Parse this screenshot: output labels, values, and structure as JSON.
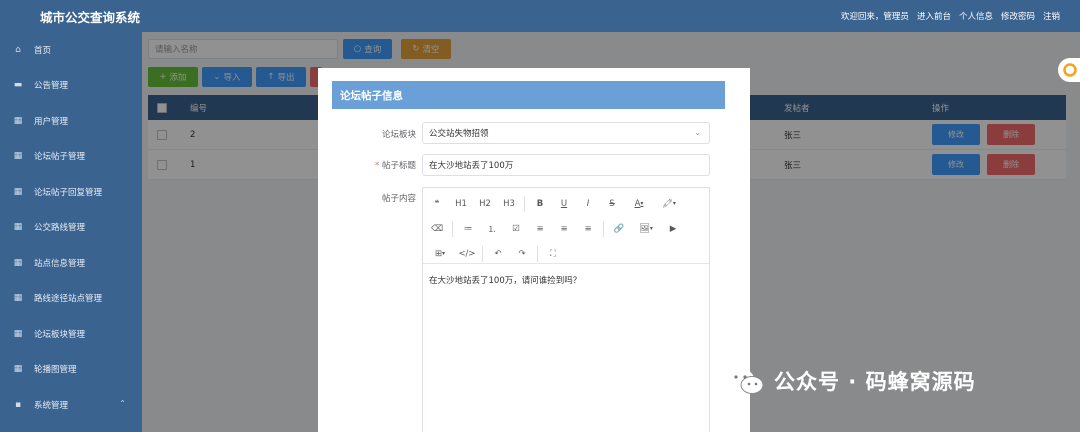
{
  "header": {
    "title": "城市公交查询系统",
    "welcome": "欢迎回来，管理员",
    "links": [
      "进入前台",
      "个人信息",
      "修改密码",
      "注销"
    ]
  },
  "sidebar": {
    "items": [
      {
        "label": "首页",
        "icon": "home-icon"
      },
      {
        "label": "公告管理",
        "icon": "message-icon"
      },
      {
        "label": "用户管理",
        "icon": "grid-icon"
      },
      {
        "label": "论坛帖子管理",
        "icon": "grid-icon"
      },
      {
        "label": "论坛帖子回复管理",
        "icon": "grid-icon"
      },
      {
        "label": "公交路线管理",
        "icon": "grid-icon"
      },
      {
        "label": "站点信息管理",
        "icon": "grid-icon"
      },
      {
        "label": "路线途径站点管理",
        "icon": "grid-icon"
      },
      {
        "label": "论坛板块管理",
        "icon": "grid-icon"
      },
      {
        "label": "轮播图管理",
        "icon": "grid-icon"
      },
      {
        "label": "系统管理",
        "icon": "settings-grid-icon"
      }
    ]
  },
  "search": {
    "placeholder": "请输入名称",
    "query_label": "查询",
    "clear_label": "清空"
  },
  "toolbar": {
    "add_label": "添加",
    "import_label": "导入",
    "export_label": "导出"
  },
  "table": {
    "headers": [
      "编号",
      "发帖者",
      "操作"
    ],
    "rows": [
      {
        "id": "2",
        "author": "张三",
        "edit": "修改",
        "delete": "删除"
      },
      {
        "id": "1",
        "author": "张三",
        "edit": "修改",
        "delete": "删除"
      }
    ]
  },
  "modal": {
    "title": "论坛帖子信息",
    "board_label": "论坛板块",
    "board_value": "公交站失物招领",
    "post_title_label": "帖子标题",
    "post_title_value": "在大沙地站丢了100万",
    "content_label": "帖子内容",
    "content_value": "在大沙地站丢了100万，请问谁捡到吗？",
    "toolbar_row1": [
      "❝",
      "H1",
      "H2",
      "H3",
      "B",
      "U",
      "I",
      "S",
      "A",
      "🖍"
    ],
    "toolbar_row2": [
      "⌫",
      "≔",
      "⒈",
      "☑",
      "≡",
      "≡",
      "≡",
      "🔗",
      "🖼",
      "▶"
    ],
    "toolbar_row3": [
      "⊞",
      "</>",
      "↶",
      "↷",
      "⛶"
    ]
  },
  "watermark": {
    "text": "公众号 · 码蜂窝源码"
  },
  "colors": {
    "header_bg": "#3a6390",
    "modal_head": "#6a9fd8",
    "primary": "#409eff",
    "danger": "#f56c6c",
    "success": "#67c23a",
    "warning": "#e6a23c"
  }
}
